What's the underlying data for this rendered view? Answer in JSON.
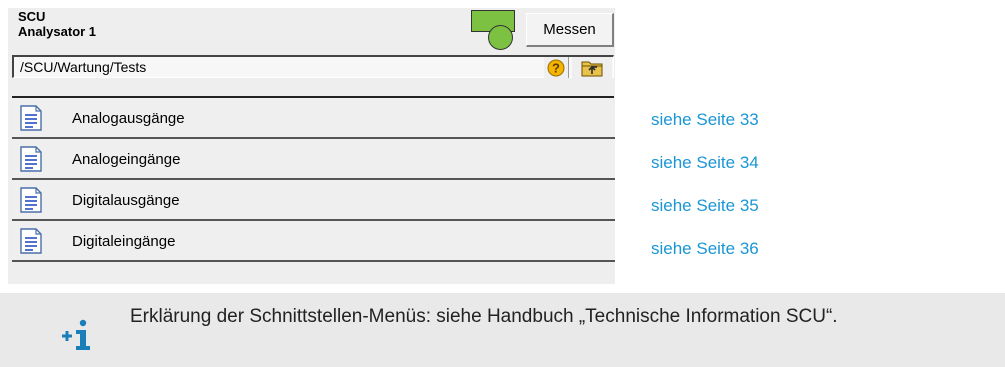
{
  "header": {
    "title_line1": "SCU",
    "title_line2": "Analysator 1",
    "measure_button": "Messen",
    "path": "/SCU/Wartung/Tests",
    "status_color": "#7dc143"
  },
  "icons": {
    "help": "help-icon",
    "folder_up": "folder-up-icon",
    "document": "document-icon",
    "info": "info-plus-icon"
  },
  "menu": {
    "items": [
      {
        "label": "Analogausgänge",
        "ref": "siehe Seite 33"
      },
      {
        "label": "Analogeingänge",
        "ref": "siehe Seite 34"
      },
      {
        "label": "Digitalausgänge",
        "ref": "siehe Seite 35"
      },
      {
        "label": "Digitaleingänge",
        "ref": "siehe Seite 36"
      }
    ]
  },
  "note": {
    "text": "Erklärung der Schnittstellen-Menüs: siehe Handbuch „Technische Information SCU“."
  },
  "colors": {
    "link": "#1a96d6",
    "panel": "#eeeeee",
    "note_bg": "#e9e9e9"
  }
}
